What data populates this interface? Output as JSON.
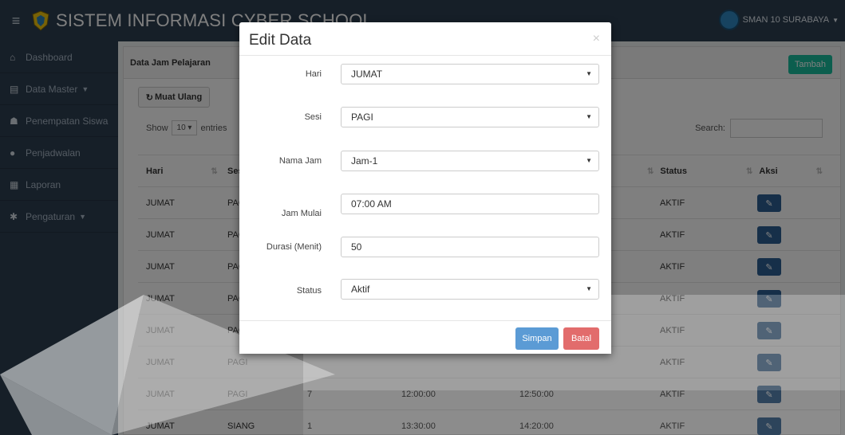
{
  "navbar": {
    "title": "SISTEM INFORMASI CYBER SCHOOL",
    "school": "SMAN 10 SURABAYA",
    "menu_icon": "hamburger-icon",
    "logo_icon": "province-emblem-icon"
  },
  "sidebar": {
    "items": [
      {
        "label": "Dashboard",
        "icon": "home-icon"
      },
      {
        "label": "Data Master",
        "icon": "list-icon",
        "caret": "▼"
      },
      {
        "label": "Penempatan Siswa",
        "icon": "users-icon"
      },
      {
        "label": "Penjadwalan",
        "icon": "circle-icon"
      },
      {
        "label": "Laporan",
        "icon": "document-icon"
      },
      {
        "label": "Pengaturan",
        "icon": "gear-icon",
        "caret": "▼"
      }
    ]
  },
  "panel": {
    "title": "Data Jam Pelajaran",
    "add_button": "Tambah",
    "reload_button": "Muat Ulang",
    "show_label": "Show",
    "entries_value": "10",
    "entries_label": "entries",
    "search_label": "Search:"
  },
  "table": {
    "headers": {
      "hari": "Hari",
      "sesi": "Sesi",
      "status": "Status",
      "aksi": "Aksi"
    },
    "rows": [
      {
        "hari": "JUMAT",
        "sesi": "PAGI",
        "jam": "",
        "mulai": "",
        "selesai": "",
        "status": "AKTIF"
      },
      {
        "hari": "JUMAT",
        "sesi": "PAGI",
        "jam": "",
        "mulai": "",
        "selesai": "",
        "status": "AKTIF"
      },
      {
        "hari": "JUMAT",
        "sesi": "PAGI",
        "jam": "",
        "mulai": "",
        "selesai": "",
        "status": "AKTIF"
      },
      {
        "hari": "JUMAT",
        "sesi": "PAGI",
        "jam": "",
        "mulai": "",
        "selesai": "",
        "status": "AKTIF"
      },
      {
        "hari": "JUMAT",
        "sesi": "PAGI",
        "jam": "",
        "mulai": "",
        "selesai": "",
        "status": "AKTIF"
      },
      {
        "hari": "JUMAT",
        "sesi": "PAGI",
        "jam": "",
        "mulai": "",
        "selesai": "",
        "status": "AKTIF"
      },
      {
        "hari": "JUMAT",
        "sesi": "PAGI",
        "jam": "7",
        "mulai": "12:00:00",
        "selesai": "12:50:00",
        "status": "AKTIF"
      },
      {
        "hari": "JUMAT",
        "sesi": "SIANG",
        "jam": "1",
        "mulai": "13:30:00",
        "selesai": "14:20:00",
        "status": "AKTIF"
      }
    ],
    "edit_icon": "edit-icon"
  },
  "modal": {
    "title": "Edit Data",
    "close": "×",
    "fields": {
      "hari": {
        "label": "Hari",
        "value": "JUMAT"
      },
      "sesi": {
        "label": "Sesi",
        "value": "PAGI"
      },
      "nama_jam": {
        "label": "Nama Jam",
        "value": "Jam-1"
      },
      "jam_mulai": {
        "label": "Jam Mulai",
        "value": "07:00 AM"
      },
      "durasi": {
        "label": "Durasi (Menit)",
        "value": "50"
      },
      "status": {
        "label": "Status",
        "value": "Aktif"
      }
    },
    "save_button": "Simpan",
    "cancel_button": "Batal"
  }
}
